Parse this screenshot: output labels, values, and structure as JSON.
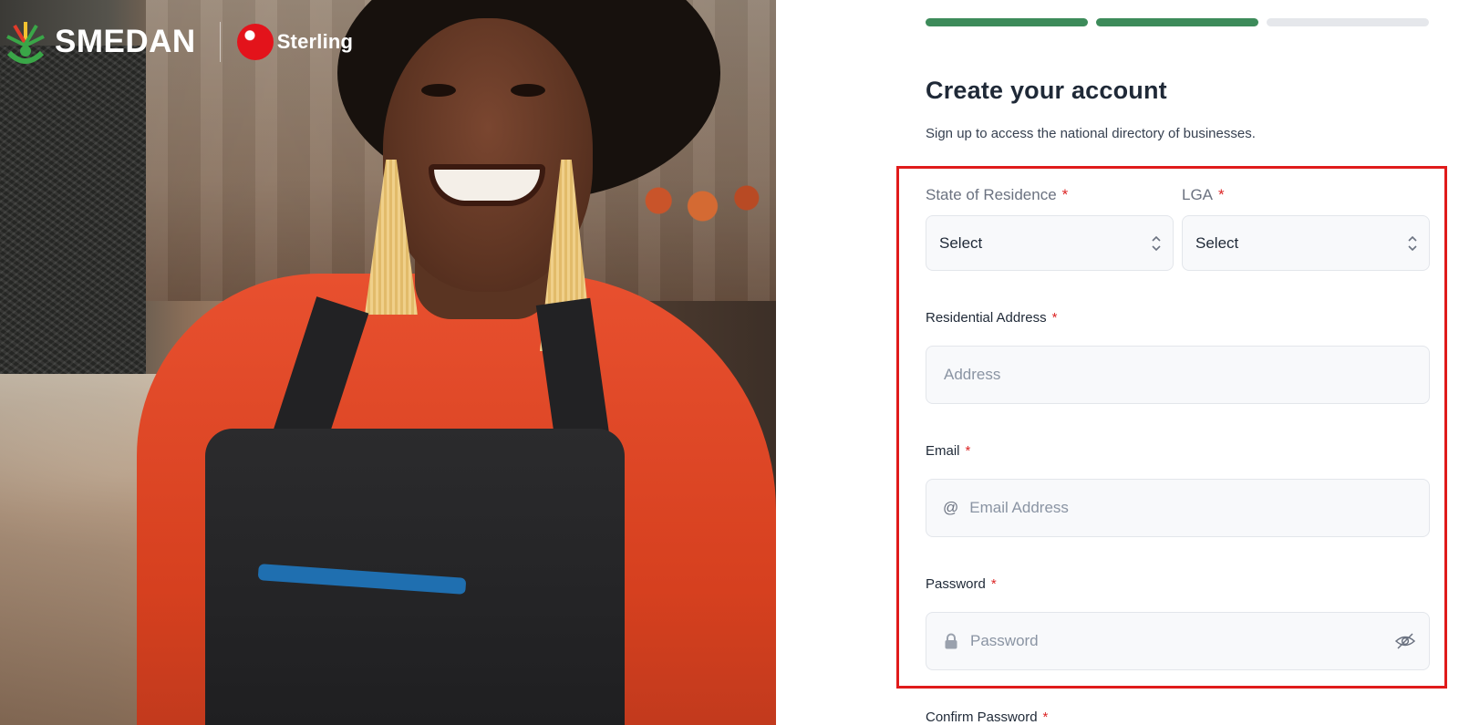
{
  "branding": {
    "smedan_name": "SMEDAN",
    "sterling_name": "Sterling"
  },
  "progress": {
    "steps_total": 3,
    "steps_completed": 2
  },
  "form": {
    "title": "Create your account",
    "subtitle": "Sign up to access the national directory of businesses.",
    "state": {
      "label": "State of Residence",
      "required_mark": "*",
      "value": "Select"
    },
    "lga": {
      "label": "LGA",
      "required_mark": "*",
      "value": "Select"
    },
    "address": {
      "label": "Residential Address",
      "required_mark": "*",
      "placeholder": "Address"
    },
    "email": {
      "label": "Email",
      "required_mark": "*",
      "prefix": "@",
      "placeholder": "Email Address"
    },
    "password": {
      "label": "Password",
      "required_mark": "*",
      "placeholder": "Password"
    },
    "confirm_password": {
      "label": "Confirm Password",
      "required_mark": "*"
    }
  },
  "colors": {
    "progress_done": "#3d8b5a",
    "progress_todo": "#e5e7eb",
    "highlight": "#e01b1b",
    "required": "#dc2626",
    "sterling_red": "#e3131b",
    "smedan_green": "#3aa648"
  },
  "icons": {
    "select_indicator": "chevron-up-down-icon",
    "email_prefix": "at-sign-icon",
    "password_prefix": "lock-icon",
    "password_toggle": "eye-off-icon"
  }
}
